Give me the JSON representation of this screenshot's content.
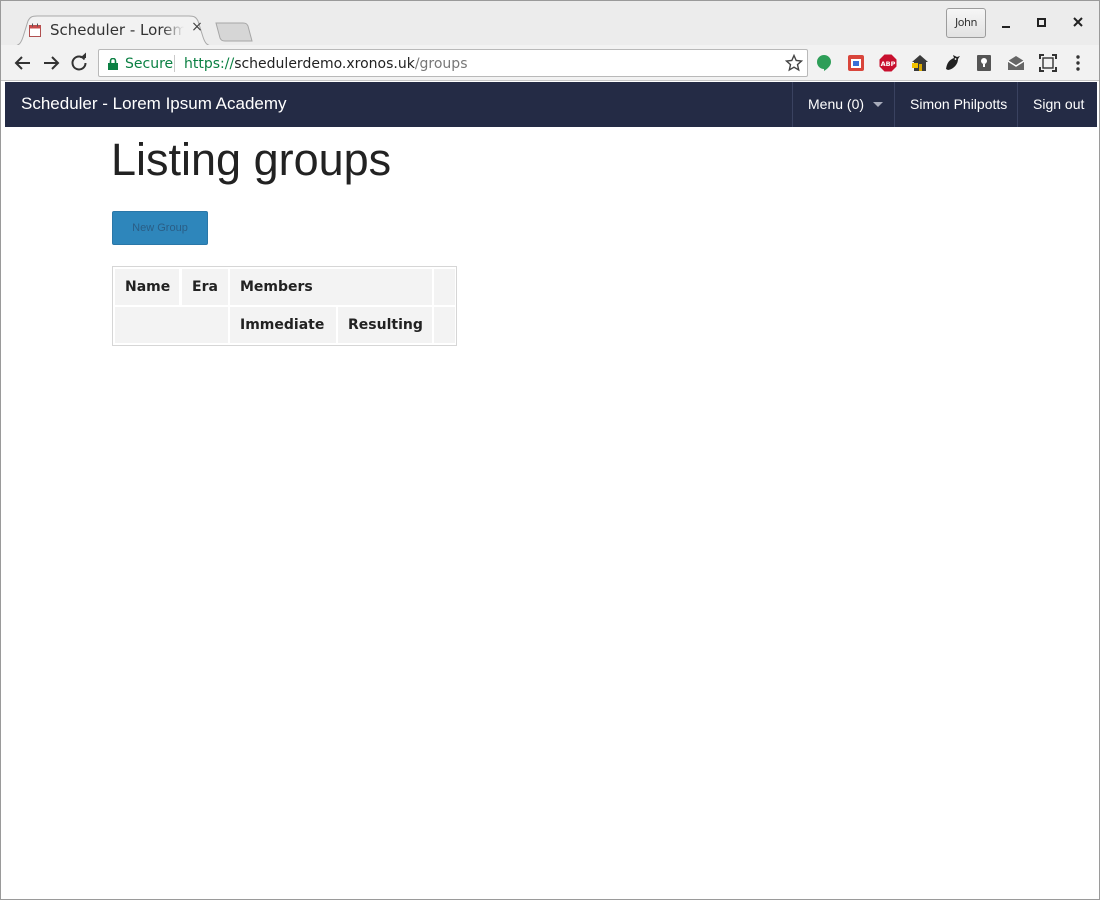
{
  "browser": {
    "tab_title": "Scheduler - Lorem Ipsum Academy",
    "tab_close": "×",
    "profile_name": "John",
    "secure_label": "Secure",
    "url_scheme": "https://",
    "url_host": "schedulerdemo.xronos.uk",
    "url_path": "/groups",
    "extension_icons": [
      "hangouts-icon",
      "calendar-extension-icon",
      "adblock-plus-icon",
      "home-extension-icon",
      "bird-extension-icon",
      "keep-extension-icon",
      "inbox-extension-icon",
      "fullscreen-extension-icon"
    ],
    "colors": {
      "secure": "#0b8043"
    }
  },
  "navbar": {
    "brand": "Scheduler - Lorem Ipsum Academy",
    "menu_label": "Menu (0)",
    "user_name": "Simon Philpotts",
    "sign_out_label": "Sign out",
    "colors": {
      "background": "#242b45"
    }
  },
  "main": {
    "title": "Listing groups",
    "new_group_label": "New Group",
    "colors": {
      "primary_button": "#2e86bb"
    },
    "table": {
      "header_row_1": [
        "Name",
        "Era",
        "Members",
        ""
      ],
      "header_row_2": [
        "",
        "Immediate",
        "Resulting",
        ""
      ],
      "rows": []
    }
  }
}
